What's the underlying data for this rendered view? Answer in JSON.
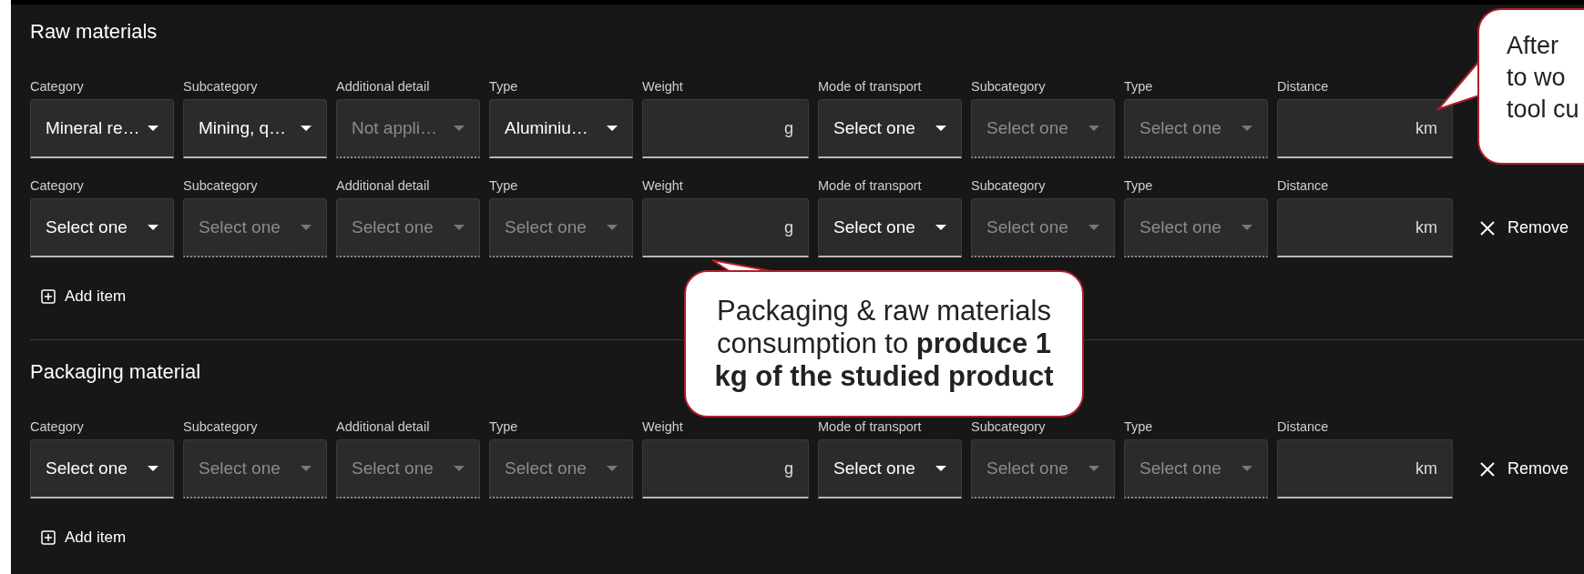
{
  "sections": [
    {
      "title": "Raw materials",
      "rows": [
        {
          "fields": [
            {
              "kind": "select",
              "label": "Category",
              "value": "Mineral re…",
              "disabled": false
            },
            {
              "kind": "select",
              "label": "Subcategory",
              "value": "Mining, q…",
              "disabled": false
            },
            {
              "kind": "select",
              "label": "Additional detail",
              "value": "Not appli…",
              "disabled": true
            },
            {
              "kind": "select",
              "label": "Type",
              "value": "Aluminiu…",
              "disabled": false
            },
            {
              "kind": "number",
              "label": "Weight",
              "unit": "g"
            },
            {
              "kind": "select",
              "label": "Mode of transport",
              "value": "Select one",
              "disabled": false
            },
            {
              "kind": "select",
              "label": "Subcategory",
              "value": "Select one",
              "disabled": true
            },
            {
              "kind": "select",
              "label": "Type",
              "value": "Select one",
              "disabled": true
            },
            {
              "kind": "number",
              "label": "Distance",
              "unit": "km"
            }
          ]
        },
        {
          "remove_label": "Remove",
          "fields": [
            {
              "kind": "select",
              "label": "Category",
              "value": "Select one",
              "disabled": false
            },
            {
              "kind": "select",
              "label": "Subcategory",
              "value": "Select one",
              "disabled": true
            },
            {
              "kind": "select",
              "label": "Additional detail",
              "value": "Select one",
              "disabled": true
            },
            {
              "kind": "select",
              "label": "Type",
              "value": "Select one",
              "disabled": true
            },
            {
              "kind": "number",
              "label": "Weight",
              "unit": "g"
            },
            {
              "kind": "select",
              "label": "Mode of transport",
              "value": "Select one",
              "disabled": false
            },
            {
              "kind": "select",
              "label": "Subcategory",
              "value": "Select one",
              "disabled": true
            },
            {
              "kind": "select",
              "label": "Type",
              "value": "Select one",
              "disabled": true
            },
            {
              "kind": "number",
              "label": "Distance",
              "unit": "km"
            }
          ]
        }
      ],
      "add_label": "Add item"
    },
    {
      "title": "Packaging material",
      "rows": [
        {
          "remove_label": "Remove",
          "fields": [
            {
              "kind": "select",
              "label": "Category",
              "value": "Select one",
              "disabled": false
            },
            {
              "kind": "select",
              "label": "Subcategory",
              "value": "Select one",
              "disabled": true
            },
            {
              "kind": "select",
              "label": "Additional detail",
              "value": "Select one",
              "disabled": true
            },
            {
              "kind": "select",
              "label": "Type",
              "value": "Select one",
              "disabled": true
            },
            {
              "kind": "number",
              "label": "Weight",
              "unit": "g"
            },
            {
              "kind": "select",
              "label": "Mode of transport",
              "value": "Select one",
              "disabled": false
            },
            {
              "kind": "select",
              "label": "Subcategory",
              "value": "Select one",
              "disabled": true
            },
            {
              "kind": "select",
              "label": "Type",
              "value": "Select one",
              "disabled": true
            },
            {
              "kind": "number",
              "label": "Distance",
              "unit": "km"
            }
          ]
        }
      ],
      "add_label": "Add item"
    }
  ],
  "callouts": [
    {
      "kind": "center",
      "text": "Packaging & raw materials consumption to **produce 1 kg of the studied product**"
    },
    {
      "kind": "edge",
      "lines": [
        "After",
        "to wo",
        "tool cu"
      ]
    }
  ]
}
